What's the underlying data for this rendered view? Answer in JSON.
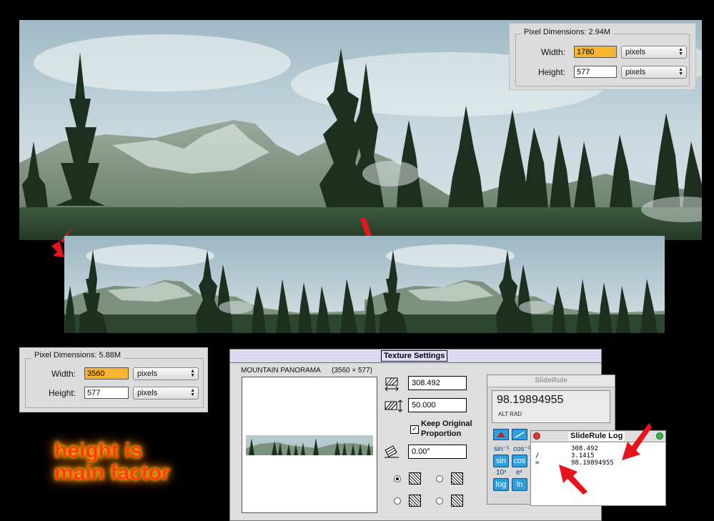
{
  "top_dimensions": {
    "title": "Pixel Dimensions:",
    "size": "2.94M",
    "width_label": "Width:",
    "width_value": "1780",
    "width_unit": "pixels",
    "height_label": "Height:",
    "height_value": "577",
    "height_unit": "pixels"
  },
  "bottom_dimensions": {
    "title": "Pixel Dimensions:",
    "size": "5.88M",
    "width_label": "Width:",
    "width_value": "3560",
    "width_unit": "pixels",
    "height_label": "Height:",
    "height_value": "577",
    "height_unit": "pixels"
  },
  "caption": {
    "line1": "height is",
    "line2": "main factor"
  },
  "texture_settings": {
    "title": "Texture Settings",
    "texture_name": "MOUNTAIN PANORAMA",
    "texture_size": "(3560 × 577)",
    "horizontal_scale": "308.492",
    "vertical_scale": "50.000",
    "keep_proportion_line1": "Keep Original",
    "keep_proportion_line2": "Proportion",
    "rotation": "0.00°"
  },
  "slide_rule": {
    "title": "SlideRule",
    "display_value": "98.19894955",
    "mode_alt": "ALT",
    "mode_rad": "RAD",
    "labels": {
      "sin_inv": "sin⁻¹",
      "cos_inv": "cos⁻¹",
      "ten_x": "10ˣ",
      "e_x": "eˣ"
    },
    "buttons": {
      "sin": "sin",
      "cos": "cos",
      "log": "log",
      "ln": "ln"
    }
  },
  "slide_rule_log": {
    "title": "SlideRule Log",
    "lines": [
      {
        "op": "",
        "value": "308.492"
      },
      {
        "op": "/",
        "value": "3.1415"
      },
      {
        "op": "=",
        "value": "98.19894955"
      }
    ]
  },
  "colors": {
    "highlight_field": "#f7b531",
    "arrow": "#e8141c",
    "caption_text": "#ff3a14",
    "caption_glow": "#ffb000",
    "calc_button": "#2c9fdd"
  }
}
